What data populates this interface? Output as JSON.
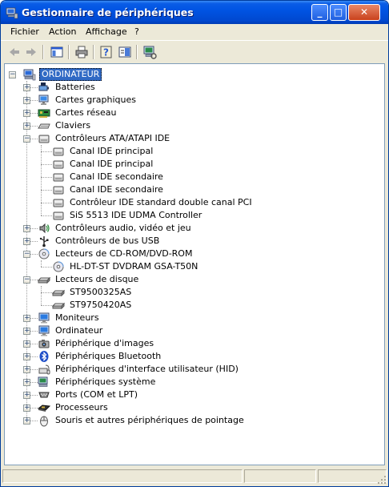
{
  "window": {
    "title": "Gestionnaire de périphériques",
    "minimize": "_",
    "maximize": "□",
    "close": "✕"
  },
  "menu": [
    "Fichier",
    "Action",
    "Affichage",
    "?"
  ],
  "toolbar": [
    "back-icon",
    "forward-icon",
    "show-hide-console-tree-icon",
    "print-icon",
    "properties-help-icon",
    "properties-icon",
    "scan-hardware-icon"
  ],
  "tree": [
    {
      "label": "ORDINATEUR",
      "level": 0,
      "expander": "-",
      "icon": "computer",
      "selected": true
    },
    {
      "label": "Batteries",
      "level": 1,
      "expander": "+",
      "icon": "battery"
    },
    {
      "label": "Cartes graphiques",
      "level": 1,
      "expander": "+",
      "icon": "display"
    },
    {
      "label": "Cartes réseau",
      "level": 1,
      "expander": "+",
      "icon": "network"
    },
    {
      "label": "Claviers",
      "level": 1,
      "expander": "+",
      "icon": "keyboard"
    },
    {
      "label": "Contrôleurs ATA/ATAPI IDE",
      "level": 1,
      "expander": "-",
      "icon": "ide"
    },
    {
      "label": "Canal IDE principal",
      "level": 2,
      "icon": "ide"
    },
    {
      "label": "Canal IDE principal",
      "level": 2,
      "icon": "ide"
    },
    {
      "label": "Canal IDE secondaire",
      "level": 2,
      "icon": "ide"
    },
    {
      "label": "Canal IDE secondaire",
      "level": 2,
      "icon": "ide"
    },
    {
      "label": "Contrôleur IDE standard double canal PCI",
      "level": 2,
      "icon": "ide"
    },
    {
      "label": "SiS 5513 IDE UDMA Controller",
      "level": 2,
      "icon": "ide"
    },
    {
      "label": "Contrôleurs audio, vidéo et jeu",
      "level": 1,
      "expander": "+",
      "icon": "audio"
    },
    {
      "label": "Contrôleurs de bus USB",
      "level": 1,
      "expander": "+",
      "icon": "usb"
    },
    {
      "label": "Lecteurs de CD-ROM/DVD-ROM",
      "level": 1,
      "expander": "-",
      "icon": "cdrom"
    },
    {
      "label": "HL-DT-ST DVDRAM GSA-T50N",
      "level": 2,
      "icon": "cdrom"
    },
    {
      "label": "Lecteurs de disque",
      "level": 1,
      "expander": "-",
      "icon": "disk"
    },
    {
      "label": "ST9500325AS",
      "level": 2,
      "icon": "disk"
    },
    {
      "label": "ST9750420AS",
      "level": 2,
      "icon": "disk"
    },
    {
      "label": "Moniteurs",
      "level": 1,
      "expander": "+",
      "icon": "monitor"
    },
    {
      "label": "Ordinateur",
      "level": 1,
      "expander": "+",
      "icon": "monitor"
    },
    {
      "label": "Périphérique d'images",
      "level": 1,
      "expander": "+",
      "icon": "camera"
    },
    {
      "label": "Périphériques Bluetooth",
      "level": 1,
      "expander": "+",
      "icon": "bluetooth"
    },
    {
      "label": "Périphériques d'interface utilisateur (HID)",
      "level": 1,
      "expander": "+",
      "icon": "hid"
    },
    {
      "label": "Périphériques système",
      "level": 1,
      "expander": "+",
      "icon": "system"
    },
    {
      "label": "Ports (COM et LPT)",
      "level": 1,
      "expander": "+",
      "icon": "port"
    },
    {
      "label": "Processeurs",
      "level": 1,
      "expander": "+",
      "icon": "cpu"
    },
    {
      "label": "Souris et autres périphériques de pointage",
      "level": 1,
      "expander": "+",
      "icon": "mouse"
    }
  ],
  "colors": {
    "selection": "#316ac5",
    "titlebar": "#0054e3",
    "chrome": "#ECE9D8"
  }
}
